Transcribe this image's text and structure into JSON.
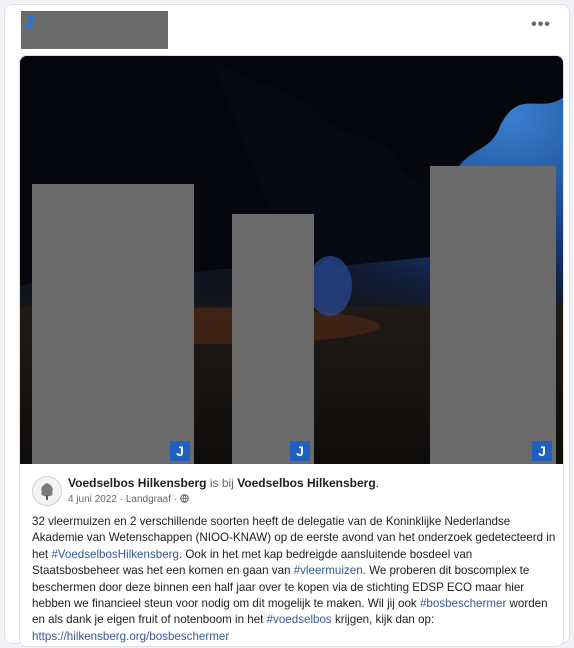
{
  "header": {
    "avatar_letter": "J",
    "more_label": "•••"
  },
  "photo": {
    "badge_letter": "J"
  },
  "post": {
    "author": "Voedselbos Hilkensberg",
    "connector": " is bij ",
    "location_page": "Voedselbos Hilkensberg",
    "date": "4 juni 2022",
    "place": "Landgraaf",
    "sep": " · ",
    "text_1": "32 vleermuizen en 2 verschillende soorten heeft de delegatie van de Koninklijke Nederlandse Akademie van Wetenschappen (NIOO-KNAW) op de eerste avond van het onderzoek gedetecteerd in het ",
    "tag_1": "#VoedselbosHilkensberg",
    "text_2": ". Ook in het met kap bedreigde aansluitende bosdeel van Staatsbosbeheer was het een komen en gaan van ",
    "tag_2": "#vleermuizen",
    "text_3": ". We proberen dit boscomplex te beschermen door deze binnen een half jaar over te kopen via de stichting EDSP ECO maar hier hebben we financieel steun voor nodig om dit mogelijk te maken. Wil jij ook ",
    "tag_3": "#bosbeschermer",
    "text_4": " worden en als dank je eigen fruit of notenboom in het ",
    "tag_4": "#voedselbos",
    "text_5": " krijgen, kijk dan op: ",
    "link": "https://hilkensberg.org/bosbeschermer"
  },
  "colors": {
    "link": "#385898",
    "badge": "#1f5fbf",
    "redaction": "#6a6a6a"
  }
}
